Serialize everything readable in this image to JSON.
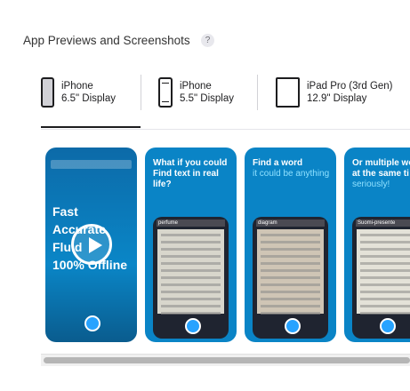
{
  "section": {
    "title": "App Previews and Screenshots",
    "help": "?"
  },
  "tabs": [
    {
      "line1": "iPhone",
      "line2": "6.5\" Display",
      "icon": "iphone-tall-icon",
      "active": true
    },
    {
      "line1": "iPhone",
      "line2": "5.5\" Display",
      "icon": "iphone-home-icon",
      "active": false
    },
    {
      "line1": "iPad Pro (3rd Gen)",
      "line2": "12.9\" Display",
      "icon": "ipad-icon",
      "active": false
    }
  ],
  "shots": [
    {
      "type": "video",
      "text": [
        "Fast",
        "Accurate",
        "Fluid",
        "100% Offline"
      ]
    },
    {
      "caption": "What if you could Find text in real life?",
      "sub": ""
    },
    {
      "caption": "Find a word",
      "sub": "it could be anything"
    },
    {
      "caption": "Or multiple wo at the same ti",
      "sub": "seriously!"
    }
  ],
  "mock_labels": [
    "perfume",
    "diagram",
    "Suomi-presente"
  ],
  "colors": {
    "accent": "#0a7bb8",
    "brand_blue": "#27a3ff"
  }
}
